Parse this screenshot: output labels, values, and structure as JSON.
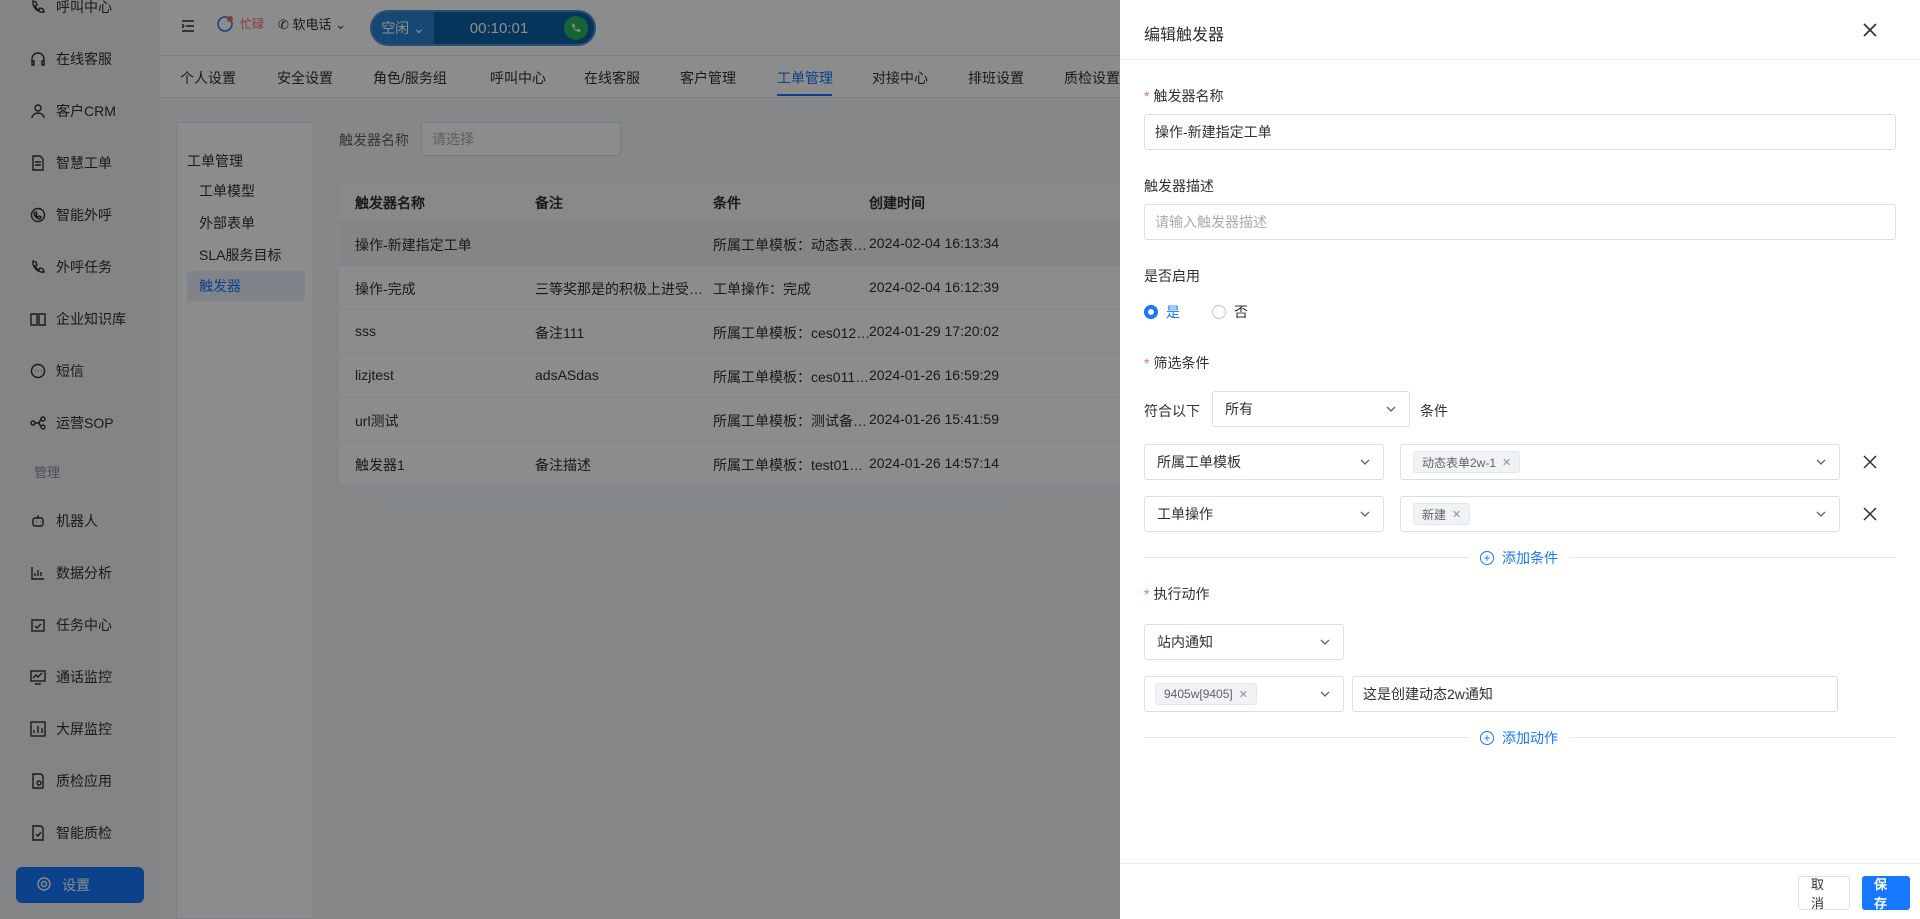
{
  "sidebar": {
    "items": [
      {
        "label": "呼叫中心",
        "icon": "phone-icon"
      },
      {
        "label": "在线客服",
        "icon": "headset-icon"
      },
      {
        "label": "客户CRM",
        "icon": "user-icon"
      },
      {
        "label": "智慧工单",
        "icon": "document-icon"
      },
      {
        "label": "智能外呼",
        "icon": "chat-phone-icon"
      },
      {
        "label": "外呼任务",
        "icon": "phone-task-icon"
      },
      {
        "label": "企业知识库",
        "icon": "book-icon"
      },
      {
        "label": "短信",
        "icon": "sms-icon"
      },
      {
        "label": "运营SOP",
        "icon": "flow-icon"
      }
    ],
    "section_label": "管理",
    "manage_items": [
      {
        "label": "机器人",
        "icon": "robot-icon"
      },
      {
        "label": "数据分析",
        "icon": "bar-chart-icon"
      },
      {
        "label": "任务中心",
        "icon": "calendar-check-icon"
      },
      {
        "label": "通话监控",
        "icon": "monitor-icon"
      },
      {
        "label": "大屏监控",
        "icon": "dashboard-icon"
      },
      {
        "label": "质检应用",
        "icon": "qc-app-icon"
      },
      {
        "label": "智能质检",
        "icon": "smart-qc-icon"
      }
    ],
    "active_item": {
      "label": "设置",
      "icon": "gear-icon"
    }
  },
  "topbar": {
    "status_busy": "忙碌",
    "softphone_label": "软电话",
    "call_state": "空闲",
    "call_timer": "00:10:01"
  },
  "tabs": [
    "个人设置",
    "安全设置",
    "角色/服务组",
    "呼叫中心",
    "在线客服",
    "客户管理",
    "工单管理",
    "对接中心",
    "排班设置",
    "质检设置"
  ],
  "active_tab": "工单管理",
  "inner_nav": {
    "group": "工单管理",
    "items": [
      "工单模型",
      "外部表单",
      "SLA服务目标"
    ],
    "active": "触发器"
  },
  "filter": {
    "label": "触发器名称",
    "placeholder": "请选择"
  },
  "table": {
    "headers": [
      "触发器名称",
      "备注",
      "条件",
      "创建时间"
    ],
    "rows": [
      [
        "操作-新建指定工单",
        "",
        "所属工单模板：动态表…",
        "2024-02-04 16:13:34"
      ],
      [
        "操作-完成",
        "三等奖那是的积极上进受打…",
        "工单操作：完成",
        "2024-02-04 16:12:39"
      ],
      [
        "sss",
        "备注111",
        "所属工单模板：ces012…",
        "2024-01-29 17:20:02"
      ],
      [
        "lizjtest",
        "adsASdas",
        "所属工单模板：ces011…",
        "2024-01-26 16:59:29"
      ],
      [
        "url测试",
        "",
        "所属工单模板：测试备…",
        "2024-01-26 15:41:59"
      ],
      [
        "触发器1",
        "备注描述",
        "所属工单模板：test01…",
        "2024-01-26 14:57:14"
      ]
    ]
  },
  "drawer": {
    "title": "编辑触发器",
    "name_label": "触发器名称",
    "name_value": "操作-新建指定工单",
    "desc_label": "触发器描述",
    "desc_placeholder": "请输入触发器描述",
    "enable_label": "是否启用",
    "enable_yes": "是",
    "enable_no": "否",
    "enabled": true,
    "filter_label": "筛选条件",
    "match_prefix": "符合以下",
    "match_value": "所有",
    "match_suffix": "条件",
    "conditions": [
      {
        "field": "所属工单模板",
        "tag": "动态表单2w-1"
      },
      {
        "field": "工单操作",
        "tag": "新建"
      }
    ],
    "add_condition": "添加条件",
    "action_label": "执行动作",
    "action_type": "站内通知",
    "action_recipient_tag": "9405w[9405]",
    "action_message": "这是创建动态2w通知",
    "add_action": "添加动作",
    "cancel": "取 消",
    "save": "保存"
  },
  "colors": {
    "accent": "#1677ff",
    "danger": "#f56c6c",
    "call_bg": "#0c61a8",
    "call_green": "#2db55d"
  }
}
